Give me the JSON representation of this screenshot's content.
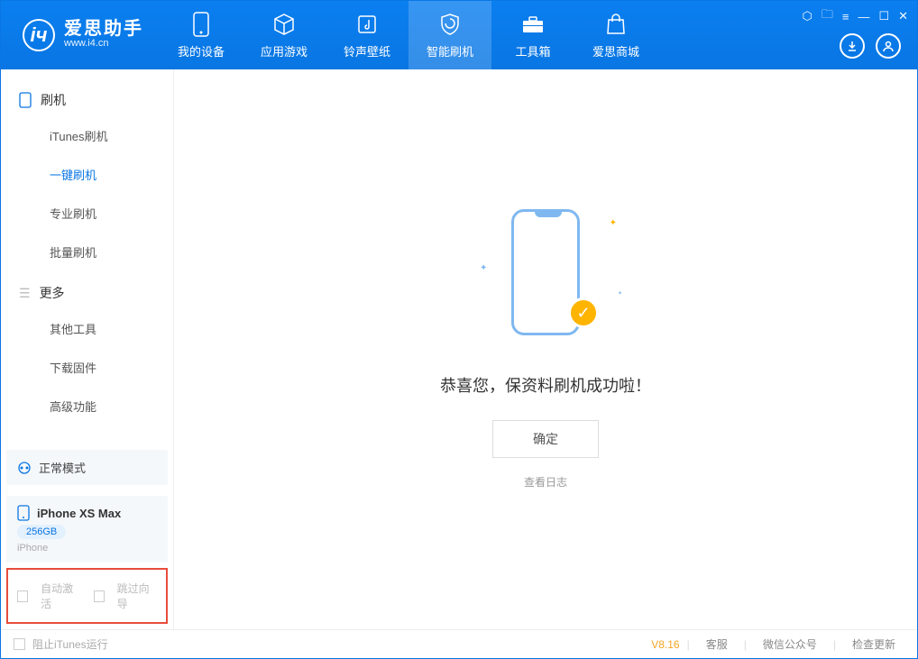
{
  "app": {
    "name_cn": "爱思助手",
    "name_en": "www.i4.cn"
  },
  "nav": [
    {
      "label": "我的设备"
    },
    {
      "label": "应用游戏"
    },
    {
      "label": "铃声壁纸"
    },
    {
      "label": "智能刷机"
    },
    {
      "label": "工具箱"
    },
    {
      "label": "爱思商城"
    }
  ],
  "sidebar": {
    "group1": "刷机",
    "items1": [
      "iTunes刷机",
      "一键刷机",
      "专业刷机",
      "批量刷机"
    ],
    "group2": "更多",
    "items2": [
      "其他工具",
      "下载固件",
      "高级功能"
    ],
    "mode": "正常模式",
    "device_name": "iPhone XS Max",
    "device_storage": "256GB",
    "device_type": "iPhone",
    "opt1": "自动激活",
    "opt2": "跳过向导"
  },
  "main": {
    "message": "恭喜您，保资料刷机成功啦！",
    "ok": "确定",
    "log": "查看日志"
  },
  "status": {
    "block_itunes": "阻止iTunes运行",
    "version": "V8.16",
    "links": [
      "客服",
      "微信公众号",
      "检查更新"
    ]
  }
}
